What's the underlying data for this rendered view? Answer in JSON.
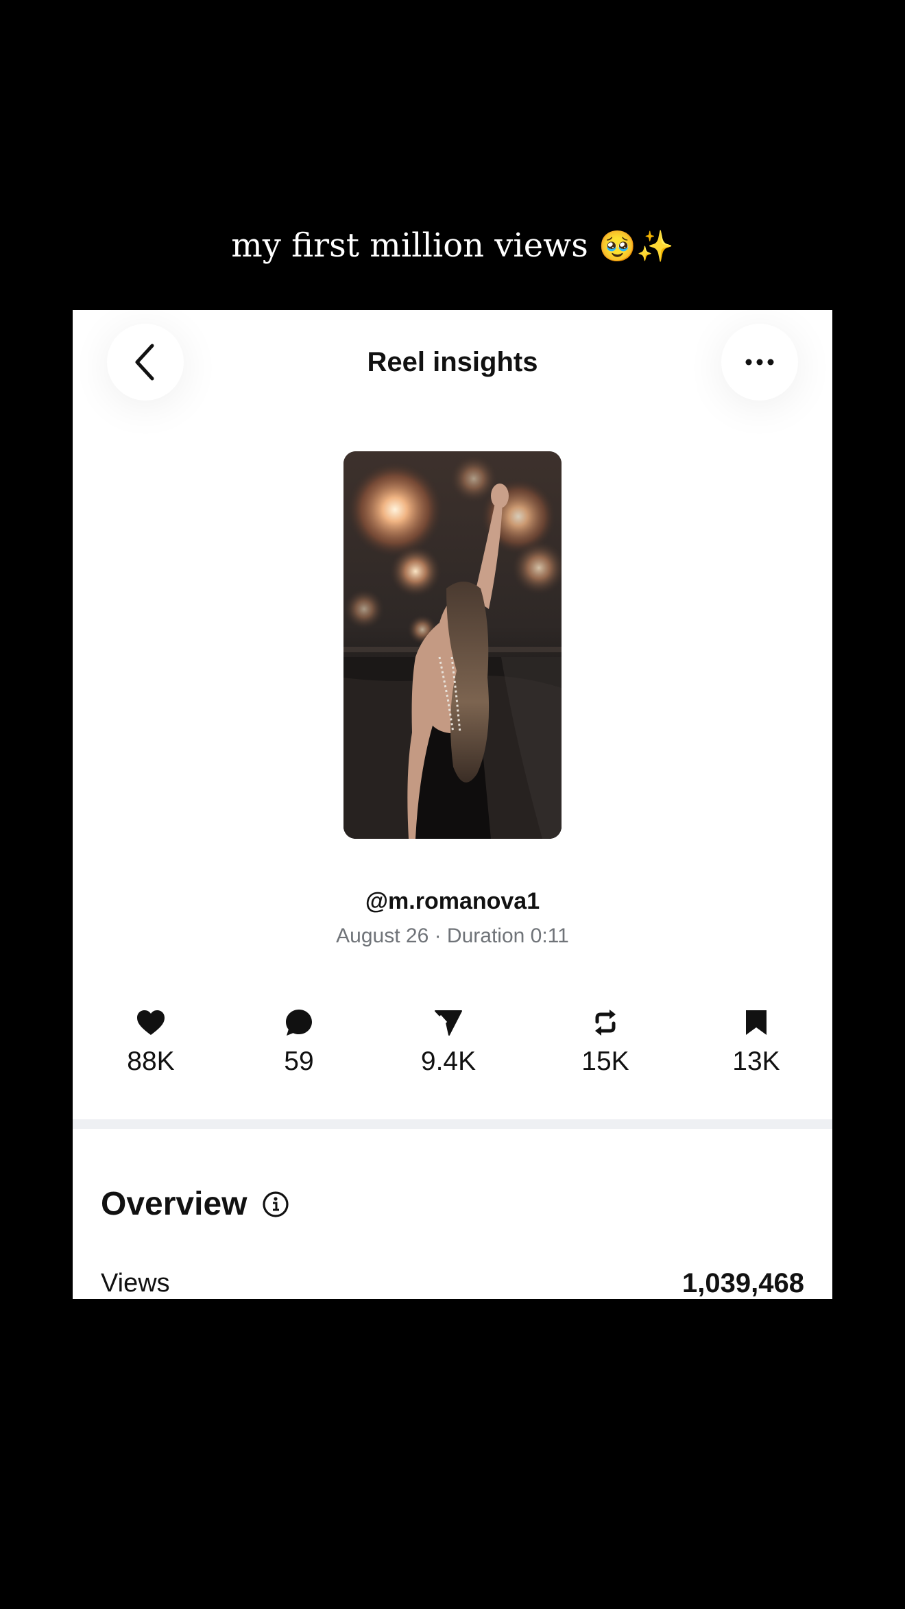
{
  "caption": {
    "text": "my first million views",
    "emoji": "🥹✨"
  },
  "header": {
    "title": "Reel insights",
    "back_icon": "chevron-left-icon",
    "more_icon": "ellipsis-icon"
  },
  "reel": {
    "thumbnail": "woman-fireworks-photo",
    "username": "@m.romanova1",
    "meta": "August 26 · Duration 0:11"
  },
  "stats": [
    {
      "icon": "heart-icon",
      "value": "88K"
    },
    {
      "icon": "comment-icon",
      "value": "59"
    },
    {
      "icon": "send-icon",
      "value": "9.4K"
    },
    {
      "icon": "repost-icon",
      "value": "15K"
    },
    {
      "icon": "bookmark-icon",
      "value": "13K"
    }
  ],
  "overview": {
    "title": "Overview",
    "info_icon": "info-icon",
    "views_label": "Views",
    "views_value": "1,039,468"
  },
  "colors": {
    "background": "#000000",
    "card": "#ffffff",
    "text": "#111111",
    "muted": "#6f7378",
    "divider": "#eef0f3"
  }
}
